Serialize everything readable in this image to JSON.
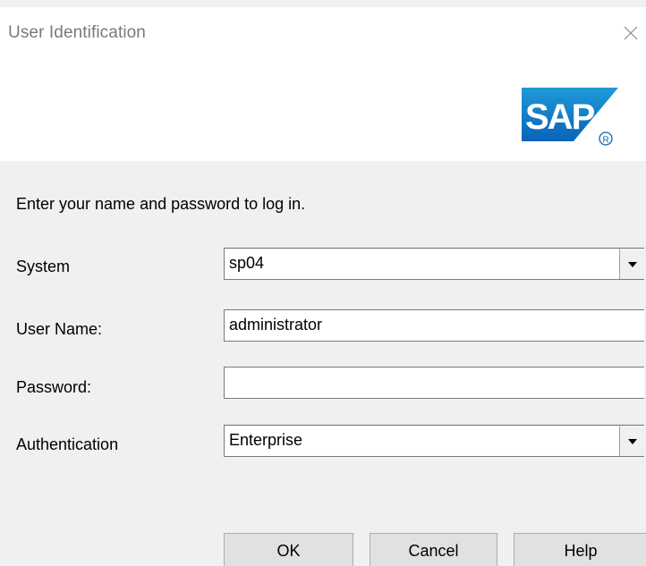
{
  "window": {
    "title": "User Identification",
    "close_icon": "close-icon"
  },
  "banner": {
    "logo_text": "SAP",
    "logo_registered": "®",
    "logo_colors": {
      "gradient_top": "#1e9ad7",
      "gradient_bottom": "#0a63b8",
      "text": "#ffffff"
    }
  },
  "form": {
    "prompt": "Enter your name and password to log in.",
    "system": {
      "label": "System",
      "value": "sp04"
    },
    "user_name": {
      "label": "User Name:",
      "value": "administrator"
    },
    "password": {
      "label": "Password:",
      "value": ""
    },
    "authentication": {
      "label": "Authentication",
      "value": "Enterprise"
    }
  },
  "buttons": {
    "ok": "OK",
    "cancel": "Cancel",
    "help": "Help"
  }
}
